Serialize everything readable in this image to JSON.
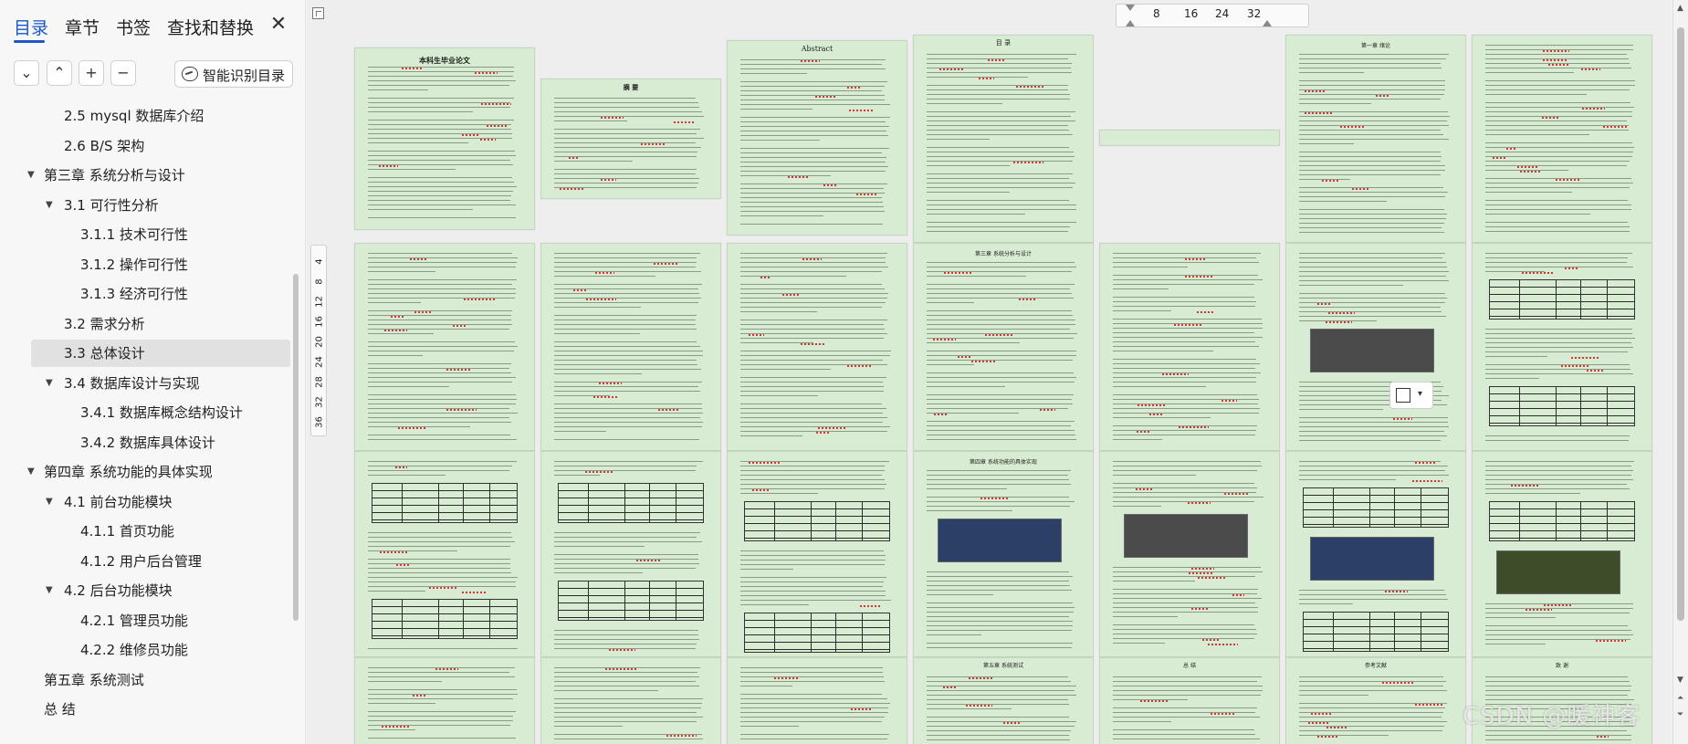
{
  "sidebar": {
    "tabs": [
      {
        "label": "目录"
      },
      {
        "label": "章节"
      },
      {
        "label": "书签"
      },
      {
        "label": "查找和替换"
      }
    ],
    "close_label": "✕",
    "toolbar": {
      "collapse_label": "⌄",
      "expand_label": "⌃",
      "add_label": "+",
      "remove_label": "−",
      "smart_label": "智能识别目录"
    },
    "outline": [
      {
        "label": "2.5   mysql 数据库介绍",
        "level": 2,
        "expanded": null
      },
      {
        "label": "2.6   B/S 架构",
        "level": 2,
        "expanded": null
      },
      {
        "label": "第三章  系统分析与设计",
        "level": 1,
        "expanded": true
      },
      {
        "label": "3.1   可行性分析",
        "level": 2,
        "expanded": true
      },
      {
        "label": "3.1.1  技术可行性",
        "level": 3,
        "expanded": null
      },
      {
        "label": "3.1.2  操作可行性",
        "level": 3,
        "expanded": null
      },
      {
        "label": "3.1.3  经济可行性",
        "level": 3,
        "expanded": null
      },
      {
        "label": "3.2   需求分析",
        "level": 2,
        "expanded": null
      },
      {
        "label": "3.3   总体设计",
        "level": 2,
        "expanded": null,
        "selected": true
      },
      {
        "label": "3.4   数据库设计与实现",
        "level": 2,
        "expanded": true
      },
      {
        "label": "3.4.1   数据库概念结构设计",
        "level": 3,
        "expanded": null
      },
      {
        "label": "3.4.2   数据库具体设计",
        "level": 3,
        "expanded": null
      },
      {
        "label": "第四章   系统功能的具体实现",
        "level": 1,
        "expanded": true
      },
      {
        "label": "4.1   前台功能模块",
        "level": 2,
        "expanded": true
      },
      {
        "label": "4.1.1  首页功能",
        "level": 3,
        "expanded": null
      },
      {
        "label": "4.1.2  用户后台管理",
        "level": 3,
        "expanded": null
      },
      {
        "label": "4.2   后台功能模块",
        "level": 2,
        "expanded": true
      },
      {
        "label": "4.2.1   管理员功能",
        "level": 3,
        "expanded": null
      },
      {
        "label": "4.2.2   维修员功能",
        "level": 3,
        "expanded": null
      },
      {
        "label": "第五章  系统测试",
        "level": 1,
        "expanded": null
      },
      {
        "label": "总  结",
        "level": 1,
        "expanded": null
      }
    ]
  },
  "ruler_h": {
    "labels": [
      "8",
      "16",
      "24",
      "32"
    ]
  },
  "ruler_v": {
    "labels": [
      "4",
      "8",
      "12",
      "16",
      "20",
      "24",
      "28",
      "32",
      "36"
    ]
  },
  "pages": {
    "cover_title": "本科生毕业论文",
    "abstract_zh_title": "摘 要",
    "abstract_en_title": "Abstract",
    "toc_title": "目 录",
    "ch1_title": "第一章  绪论",
    "ch3_title": "第三章  系统分析与设计",
    "ch4_title": "第四章  系统功能的具体实现",
    "ch5_title": "第五章  系统测试",
    "summary_title": "总 结",
    "refs_title": "参考文献",
    "thanks_title": "致 谢"
  },
  "watermark": "CSDN @暖神客",
  "colors": {
    "accent": "#1a57c9",
    "page_bg": "#d7ecd2",
    "selected_item": "#e1e1e1"
  }
}
